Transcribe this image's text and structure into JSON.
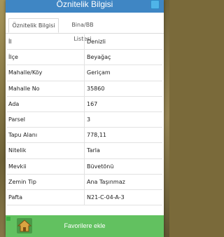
{
  "header": {
    "title": "Öznitelik Bilgisi"
  },
  "tabs": [
    {
      "label": "Öznitelik Bilgisi",
      "active": true
    },
    {
      "label": "Bina/BB Listesi",
      "active": false
    }
  ],
  "attributes": [
    {
      "key": "İl",
      "value": "Denizli"
    },
    {
      "key": "İlçe",
      "value": "Beyağaç"
    },
    {
      "key": "Mahalle/Köy",
      "value": "Gerіçam"
    },
    {
      "key": "Mahalle No",
      "value": "35860"
    },
    {
      "key": "Ada",
      "value": "167"
    },
    {
      "key": "Parsel",
      "value": "3"
    },
    {
      "key": "Tapu Alanı",
      "value": "778,11"
    },
    {
      "key": "Nitelik",
      "value": "Tarla"
    },
    {
      "key": "Mevkii",
      "value": "Büvetönü"
    },
    {
      "key": "Zemin Tip",
      "value": "Ana Taşınmaz"
    },
    {
      "key": "Pafta",
      "value": "N21-C-04-A-3"
    }
  ],
  "footer": {
    "favorite_label": "Favorilere ekle"
  },
  "colors": {
    "header": "#3f86c4",
    "fav_bar": "#62c160"
  }
}
